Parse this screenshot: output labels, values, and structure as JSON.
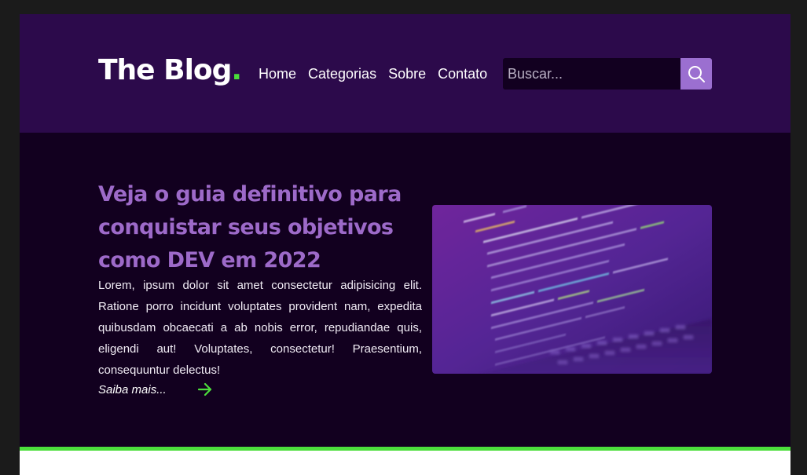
{
  "brand": {
    "name": "The Blog",
    "dot": ".",
    "colors": {
      "accent": "#4ade3a",
      "primary": "#9d6ac9",
      "header_bg": "#2c0a4b",
      "hero_bg": "#12001f"
    }
  },
  "nav": {
    "items": [
      {
        "label": "Home"
      },
      {
        "label": "Categorias"
      },
      {
        "label": "Sobre"
      },
      {
        "label": "Contato"
      }
    ]
  },
  "search": {
    "placeholder": "Buscar...",
    "value": "",
    "button_icon": "search-icon"
  },
  "hero": {
    "title": "Veja o guia definitivo para conquistar seus objetivos como DEV em 2022",
    "text": "Lorem, ipsum dolor sit amet consectetur adipisicing elit. Ratione porro incidunt voluptates provident nam, expedita quibusdam obcaecati a ab nobis error, repudiandae quis, eligendi aut! Voluptates, consectetur! Praesentium, consequuntur delectus!",
    "read_more": "Saiba mais...",
    "read_more_icon": "arrow-right-icon",
    "image": "laptop-code-image"
  }
}
